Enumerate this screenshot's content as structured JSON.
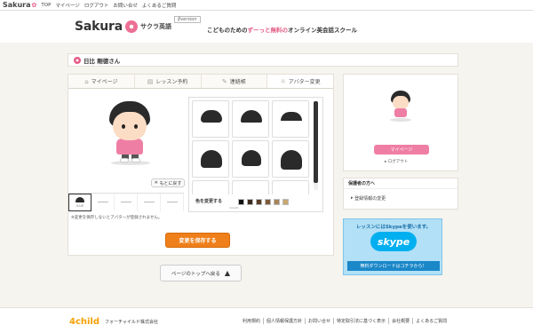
{
  "topbar": {
    "logo": "Sakura",
    "links": [
      "TOP",
      "マイページ",
      "ログアウト",
      "お問い合せ",
      "よくあるご質問"
    ]
  },
  "header": {
    "brand": "Sakura",
    "subtitle": "サクラ英語",
    "version": "βversion",
    "tagline_pre": "こどものための",
    "tagline_pink": "ずーっと無料の",
    "tagline_post": "オンライン英会話スクール"
  },
  "userbar": {
    "name": "日比 剛德さん"
  },
  "tabs": [
    {
      "icon": "house-icon",
      "label": "マイページ"
    },
    {
      "icon": "book-icon",
      "label": "レッスン予約"
    },
    {
      "icon": "pencil-icon",
      "label": "連絡帳"
    },
    {
      "icon": "sun-icon",
      "label": "アバター変更"
    }
  ],
  "editor": {
    "reset_label": "もとに戻す",
    "parts": [
      "HAIR",
      "",
      "",
      "",
      ""
    ],
    "note": "※変更を保存しないとアバターが登録されません。",
    "color_label": "色を変更する",
    "color_sub": "COLOR",
    "swatches": [
      "#111111",
      "#3a2a1e",
      "#5a3d28",
      "#7d5b3a",
      "#a68458",
      "#c9a771"
    ],
    "save_label": "変更を保存する"
  },
  "totop": "ページのトップへ戻る",
  "side": {
    "mypage_button": "マイページ",
    "logout": "ログアウト",
    "guardian_title": "保護者の方へ",
    "guardian_link": "登録情報の変更"
  },
  "skype": {
    "top": "レッスンにはSkypeを使います。",
    "logo": "skype",
    "bottom": "無料ダウンロードはコチラから！"
  },
  "footer": {
    "logo": "4child",
    "company": "フォーチャイルド株式会社",
    "links": [
      "利用規約",
      "個人情報保護方針",
      "お問い合せ",
      "特定取引法に基づく表示",
      "会社概要",
      "よくあるご質問"
    ]
  }
}
